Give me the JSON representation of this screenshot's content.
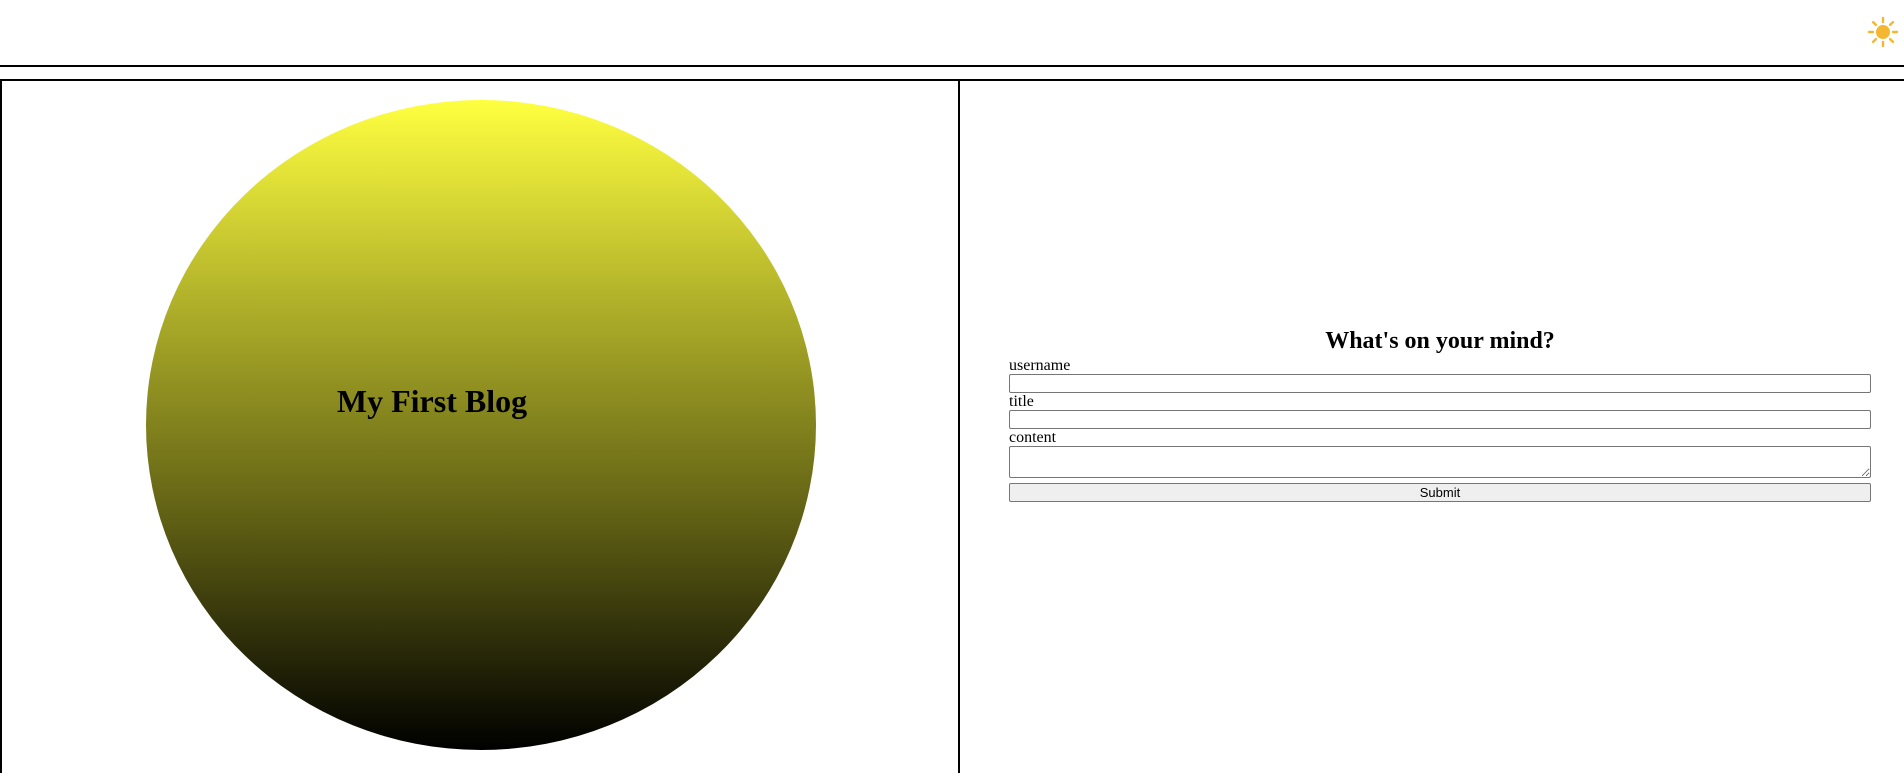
{
  "header": {
    "theme_icon": "sun-icon",
    "theme_icon_color": "#f5b731"
  },
  "hero": {
    "title": "My First Blog",
    "gradient_top": "#ffff40",
    "gradient_bottom": "#000000"
  },
  "form": {
    "heading": "What's on your mind?",
    "username_label": "username",
    "username_value": "",
    "title_label": "title",
    "title_value": "",
    "content_label": "content",
    "content_value": "",
    "submit_label": "Submit"
  }
}
